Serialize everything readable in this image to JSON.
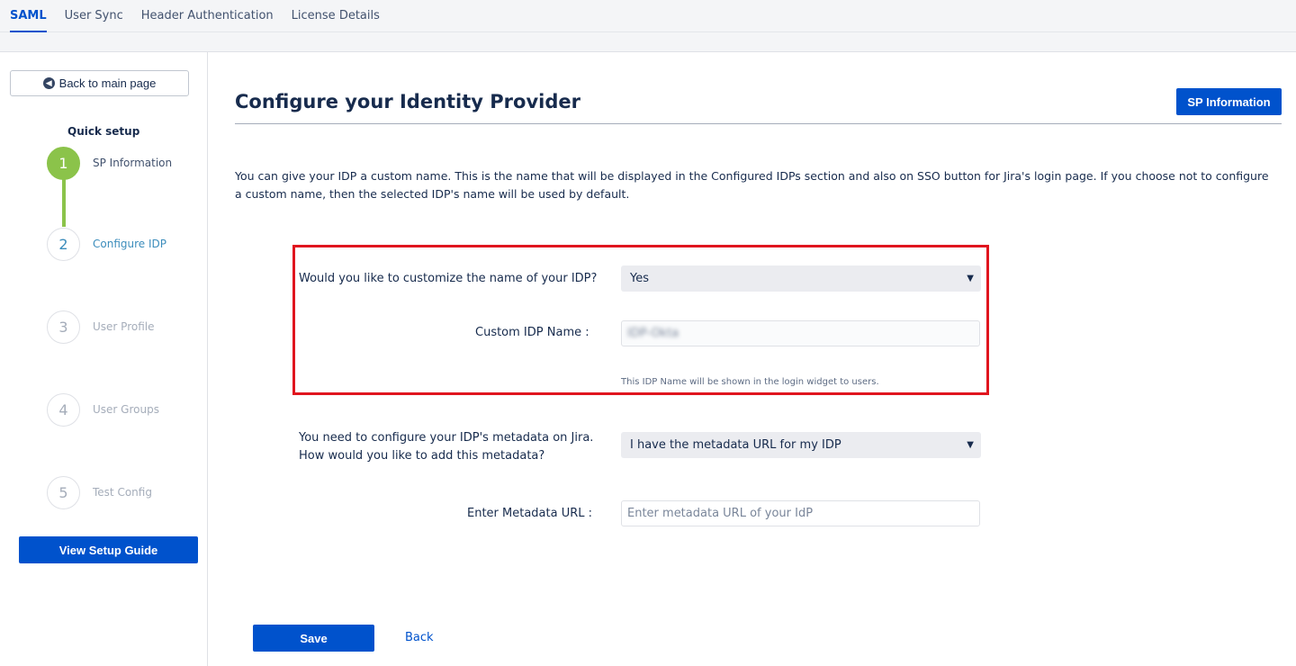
{
  "tabs": [
    "SAML",
    "User Sync",
    "Header Authentication",
    "License Details"
  ],
  "sidebar": {
    "back_label": "Back to main page",
    "quick_setup": "Quick setup",
    "steps": [
      {
        "num": "1",
        "label": "SP Information"
      },
      {
        "num": "2",
        "label": "Configure IDP"
      },
      {
        "num": "3",
        "label": "User Profile"
      },
      {
        "num": "4",
        "label": "User Groups"
      },
      {
        "num": "5",
        "label": "Test Config"
      }
    ],
    "guide_label": "View Setup Guide"
  },
  "main": {
    "title": "Configure your Identity Provider",
    "sp_info_label": "SP Information",
    "description": "You can give your IDP a custom name. This is the name that will be displayed in the Configured IDPs section and also on SSO button for Jira's login page. If you choose not to configure a custom name, then the selected IDP's name will be used by default.",
    "customize_label": "Would you like to customize the name of your IDP?",
    "customize_value": "Yes",
    "custom_name_label": "Custom IDP Name :",
    "custom_name_value": "IDP-Okta",
    "custom_name_hint": "This IDP Name will be shown in the login widget to users.",
    "metadata_label_1": "You need to configure your IDP's metadata on Jira.",
    "metadata_label_2": "How would you like to add this metadata?",
    "metadata_option": "I have the metadata URL for my IDP",
    "metadata_url_label": "Enter Metadata URL :",
    "metadata_url_placeholder": "Enter metadata URL of your IdP",
    "save_label": "Save",
    "back_label": "Back"
  },
  "colors": {
    "accent": "#0052cc",
    "step_done": "#8bc34a",
    "highlight": "#e0151e"
  }
}
